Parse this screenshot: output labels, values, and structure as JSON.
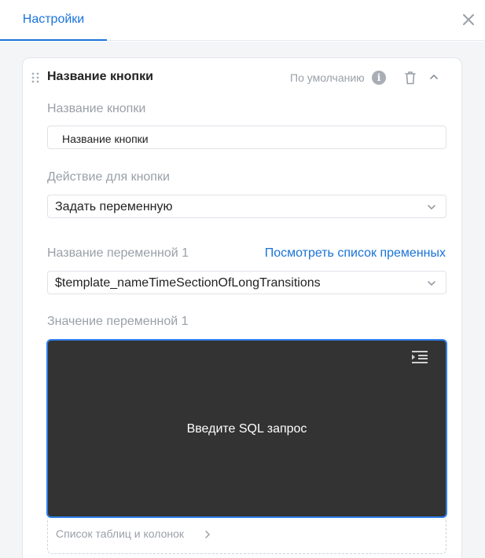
{
  "header": {
    "tab_label": "Настройки"
  },
  "card": {
    "title": "Название кнопки",
    "default_label": "По умолчанию",
    "info_glyph": "i"
  },
  "fields": {
    "button_name_label": "Название кнопки",
    "button_name_value": "Название кнопки",
    "action_label": "Действие для кнопки",
    "action_value": "Задать переменную",
    "variable_name_label": "Название переменной 1",
    "variable_list_link": "Посмотреть список пременных",
    "variable_name_value": "$template_nameTimeSectionOfLongTransitions",
    "variable_value_label": "Значение переменной 1"
  },
  "editor": {
    "placeholder": "Введите SQL запрос"
  },
  "tables": {
    "label": "Список таблиц и колонок"
  },
  "colors": {
    "accent": "#1a73d9",
    "editor_bg": "#333333",
    "editor_border": "#2f80ed"
  },
  "icons": [
    "close-icon",
    "drag-handle-icon",
    "info-icon",
    "trash-icon",
    "chevron-up-icon",
    "chevron-down-icon",
    "indent-icon",
    "chevron-right-icon"
  ]
}
